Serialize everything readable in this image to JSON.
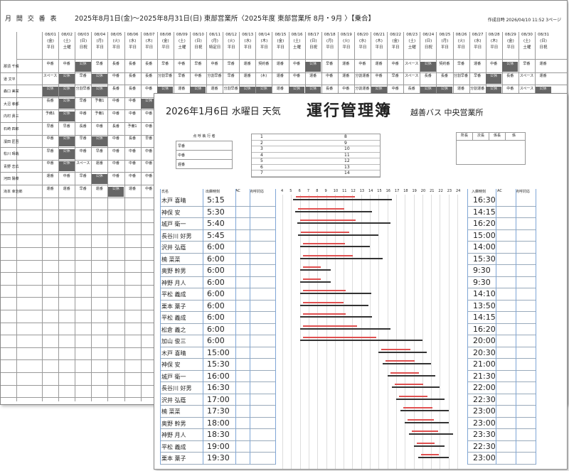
{
  "back_sheet": {
    "title": "月 間 交 番 表",
    "range": "2025年8月1日(金)～2025年8月31日(日)  東部営業所〈2025年度 東部営業所  8月・9月 〉【乗合】",
    "created": "作成日時 2026/04/10 11:52  3ページ",
    "days": [
      {
        "date": "08/01",
        "wd": "(金)",
        "type": "平日"
      },
      {
        "date": "08/02",
        "wd": "(土)",
        "type": "土曜"
      },
      {
        "date": "08/03",
        "wd": "(日)",
        "type": "日祝"
      },
      {
        "date": "08/04",
        "wd": "(月)",
        "type": "平日"
      },
      {
        "date": "08/05",
        "wd": "(火)",
        "type": "平日"
      },
      {
        "date": "08/06",
        "wd": "(水)",
        "type": "平日"
      },
      {
        "date": "08/07",
        "wd": "(木)",
        "type": "平日"
      },
      {
        "date": "08/08",
        "wd": "(金)",
        "type": "平日"
      },
      {
        "date": "08/09",
        "wd": "(土)",
        "type": "土曜"
      },
      {
        "date": "08/10",
        "wd": "(日)",
        "type": "日祝"
      },
      {
        "date": "08/11",
        "wd": "(月)",
        "type": "特定日"
      },
      {
        "date": "08/12",
        "wd": "(火)",
        "type": "平日"
      },
      {
        "date": "08/13",
        "wd": "(水)",
        "type": "平日"
      },
      {
        "date": "08/14",
        "wd": "(木)",
        "type": "平日"
      },
      {
        "date": "08/15",
        "wd": "(金)",
        "type": "平日"
      },
      {
        "date": "08/16",
        "wd": "(土)",
        "type": "土曜"
      },
      {
        "date": "08/17",
        "wd": "(日)",
        "type": "日祝"
      },
      {
        "date": "08/18",
        "wd": "(月)",
        "type": "平日"
      },
      {
        "date": "08/19",
        "wd": "(火)",
        "type": "平日"
      },
      {
        "date": "08/20",
        "wd": "(水)",
        "type": "平日"
      },
      {
        "date": "08/21",
        "wd": "(木)",
        "type": "平日"
      },
      {
        "date": "08/22",
        "wd": "(金)",
        "type": "平日"
      },
      {
        "date": "08/23",
        "wd": "(土)",
        "type": "土曜"
      },
      {
        "date": "08/24",
        "wd": "(日)",
        "type": "日祝"
      },
      {
        "date": "08/25",
        "wd": "(月)",
        "type": "平日"
      },
      {
        "date": "08/26",
        "wd": "(火)",
        "type": "平日"
      },
      {
        "date": "08/27",
        "wd": "(水)",
        "type": "平日"
      },
      {
        "date": "08/28",
        "wd": "(木)",
        "type": "平日"
      },
      {
        "date": "08/29",
        "wd": "(金)",
        "type": "平日"
      },
      {
        "date": "08/30",
        "wd": "(土)",
        "type": "土曜"
      },
      {
        "date": "08/31",
        "wd": "(日)",
        "type": "日祝"
      }
    ],
    "names": [
      "那須 千晴",
      "道 文平",
      "森口 美栄",
      "大沼 孝都",
      "内村 貴三",
      "石崎 四郎",
      "濱田 匠吾",
      "松川 晴哉",
      "青野 志広",
      "河田 陽菜",
      "滝本 幸治郎"
    ],
    "cells": [
      [
        "中番",
        "中番",
        "公休",
        "早番",
        "長番",
        "長番",
        "長番",
        "早番",
        "中番",
        "早番",
        "中番",
        "早番",
        "運番",
        "契約番",
        "運番",
        "中番",
        "公休",
        "早番",
        "運番",
        "中番",
        "運番",
        "中番",
        "スペース",
        "公休",
        "契約番",
        "早番",
        "運番",
        "中番",
        "公休",
        "早番",
        "運番"
      ],
      [
        "スペース",
        "公休",
        "早番",
        "公休",
        "中番",
        "長番",
        "長番",
        "分割早番",
        "早番",
        "中番",
        "分割早番",
        "早番",
        "運番",
        "(木)",
        "運番",
        "中番",
        "運番",
        "中番",
        "運番",
        "分割運番",
        "中番",
        "早番",
        "スペース",
        "長番",
        "長番",
        "分割早番",
        "早番",
        "公休",
        "長番",
        "スペース",
        "運番"
      ],
      [
        "公休",
        "公休",
        "分割早番",
        "公休",
        "長番",
        "長番",
        "中番",
        "公休",
        "運番",
        "公休",
        "運番",
        "分割早番",
        "公休",
        "公休",
        "運番",
        "公休",
        "公休",
        "長番",
        "中番",
        "分割運番",
        "公休",
        "中番",
        "長番",
        "公休",
        "公休",
        "運番",
        "分割運番",
        "公休",
        "中番",
        "スペース",
        "公休"
      ],
      [
        "長番",
        "公休",
        "早番",
        "予備1",
        "中番",
        "中番",
        "公休",
        "中番",
        "中番",
        "公休",
        "中番",
        "公休",
        "中番",
        "中番",
        "中番",
        "中番",
        "中番",
        "中番",
        "中番",
        "中番",
        "公休",
        "中番",
        "中番",
        "中番",
        "中番",
        "中番",
        "中番",
        "中番",
        "中番",
        "中番",
        "中番"
      ],
      [
        "予備1",
        "公休",
        "中番",
        "予備1",
        "中番",
        "中番",
        "中番",
        "中番",
        "中番",
        "中番",
        "中番",
        "中番",
        "中番",
        "中番",
        "中番",
        "中番",
        "中番",
        "中番",
        "中番",
        "中番",
        "中番",
        "中番",
        "中番",
        "中番",
        "中番",
        "中番",
        "中番",
        "中番",
        "中番",
        "中番",
        "中番"
      ],
      [
        "早番",
        "早番",
        "長番",
        "中番",
        "長番",
        "予備1",
        "中番",
        "中番",
        "中番",
        "中番",
        "中番",
        "中番",
        "中番",
        "中番",
        "中番",
        "中番",
        "中番",
        "中番",
        "中番",
        "中番",
        "中番",
        "中番",
        "中番",
        "中番",
        "中番",
        "中番",
        "中番",
        "中番",
        "中番",
        "中番",
        "早番"
      ],
      [
        "中番",
        "公休",
        "早番",
        "公休",
        "中番",
        "長番",
        "早番",
        "早番",
        "中番",
        "中番",
        "中番",
        "中番",
        "中番",
        "中番",
        "中番",
        "中番",
        "中番",
        "中番",
        "中番",
        "中番",
        "中番",
        "中番",
        "中番",
        "中番",
        "中番",
        "中番",
        "中番",
        "中番",
        "中番",
        "中番",
        "中番"
      ],
      [
        "早番",
        "公休",
        "中番",
        "早番",
        "中番",
        "中番",
        "中番",
        "中番",
        "中番",
        "中番",
        "中番",
        "中番",
        "中番",
        "中番",
        "中番",
        "中番",
        "中番",
        "中番",
        "中番",
        "中番",
        "中番",
        "中番",
        "中番",
        "中番",
        "中番",
        "中番",
        "中番",
        "中番",
        "中番",
        "中番",
        "公休"
      ],
      [
        "中番",
        "公休",
        "スペース",
        "運番",
        "中番",
        "中番",
        "中番",
        "中番",
        "中番",
        "中番",
        "中番",
        "中番",
        "中番",
        "中番",
        "中番",
        "中番",
        "中番",
        "中番",
        "中番",
        "中番",
        "中番",
        "中番",
        "中番",
        "中番",
        "中番",
        "中番",
        "中番",
        "中番",
        "中番",
        "中番",
        "分割早番"
      ],
      [
        "運番",
        "中番",
        "早番",
        "公休",
        "中番",
        "中番",
        "中番",
        "中番",
        "中番",
        "中番",
        "中番",
        "中番",
        "中番",
        "中番",
        "中番",
        "中番",
        "中番",
        "中番",
        "中番",
        "中番",
        "中番",
        "中番",
        "中番",
        "中番",
        "中番",
        "中番",
        "中番",
        "中番",
        "中番",
        "中番",
        "公休"
      ],
      [
        "運番",
        "運番",
        "早番",
        "運番",
        "公休",
        "運番",
        "中番",
        "中番",
        "中番",
        "中番",
        "中番",
        "中番",
        "中番",
        "中番",
        "中番",
        "中番",
        "中番",
        "中番",
        "中番",
        "中番",
        "中番",
        "中番",
        "中番",
        "中番",
        "中番",
        "中番",
        "中番",
        "中番",
        "中番",
        "中番",
        "公休"
      ]
    ],
    "dark_value": "公休"
  },
  "front_sheet": {
    "date_line": "2026年1月6日  水曜日  天気",
    "title": "運行管理簿",
    "company": "越善バス  中央営業所",
    "roll_call": {
      "heading": "点 呼 執 行 者",
      "rows": [
        "早番",
        "中番",
        "遅番"
      ]
    },
    "numbers_left": [
      "1",
      "2",
      "3",
      "4",
      "5",
      "6",
      "7"
    ],
    "numbers_right": [
      "8",
      "9",
      "10",
      "11",
      "12",
      "13",
      "14"
    ],
    "stamps": [
      "所長",
      "次長",
      "係長",
      "係"
    ],
    "col_headers": {
      "name": "氏名",
      "start": "出庫時刻",
      "ac": "AC",
      "alcohol": "点呼対応",
      "end": "入庫時刻",
      "ac2": "AC",
      "alcohol2": "点呼対応"
    },
    "hours": [
      "4",
      "5",
      "6",
      "7",
      "8",
      "9",
      "10",
      "11",
      "12",
      "13",
      "14",
      "15",
      "16",
      "17",
      "18",
      "19",
      "20",
      "21",
      "22",
      "23",
      "24"
    ],
    "rows": [
      {
        "name": "木戸 喜晴",
        "start": "5:15",
        "end": "16:30"
      },
      {
        "name": "神保 安",
        "start": "5:30",
        "end": "14:15"
      },
      {
        "name": "城戸 衛一",
        "start": "5:40",
        "end": "16:20"
      },
      {
        "name": "長谷川 好男",
        "start": "5:45",
        "end": "15:00"
      },
      {
        "name": "沢井 弘蔭",
        "start": "6:00",
        "end": "14:00"
      },
      {
        "name": "楠 菜菜",
        "start": "6:00",
        "end": "15:30"
      },
      {
        "name": "奥野 幹男",
        "start": "6:00",
        "end": "9:30"
      },
      {
        "name": "神野 月人",
        "start": "6:00",
        "end": "9:30"
      },
      {
        "name": "平松 義成",
        "start": "6:00",
        "end": "14:10"
      },
      {
        "name": "栗本 葉子",
        "start": "6:00",
        "end": "13:50"
      },
      {
        "name": "平松 義成",
        "start": "6:00",
        "end": "14:15"
      },
      {
        "name": "松倉 義之",
        "start": "6:00",
        "end": "16:20"
      },
      {
        "name": "加山 俊三",
        "start": "6:00",
        "end": "20:00"
      },
      {
        "name": "木戸 喜晴",
        "start": "15:00",
        "end": "20:30"
      },
      {
        "name": "神保 安",
        "start": "15:30",
        "end": "21:00"
      },
      {
        "name": "城戸 衛一",
        "start": "16:00",
        "end": "21:30"
      },
      {
        "name": "長谷川 好男",
        "start": "16:30",
        "end": "22:00"
      },
      {
        "name": "沢井 弘蔭",
        "start": "17:00",
        "end": "22:30"
      },
      {
        "name": "楠 菜菜",
        "start": "17:30",
        "end": "23:00"
      },
      {
        "name": "奥野 幹男",
        "start": "18:00",
        "end": "23:00"
      },
      {
        "name": "神野 月人",
        "start": "18:30",
        "end": "23:30"
      },
      {
        "name": "平松 義成",
        "start": "19:00",
        "end": "22:30"
      },
      {
        "name": "栗本 葉子",
        "start": "19:30",
        "end": "23:00"
      }
    ]
  }
}
